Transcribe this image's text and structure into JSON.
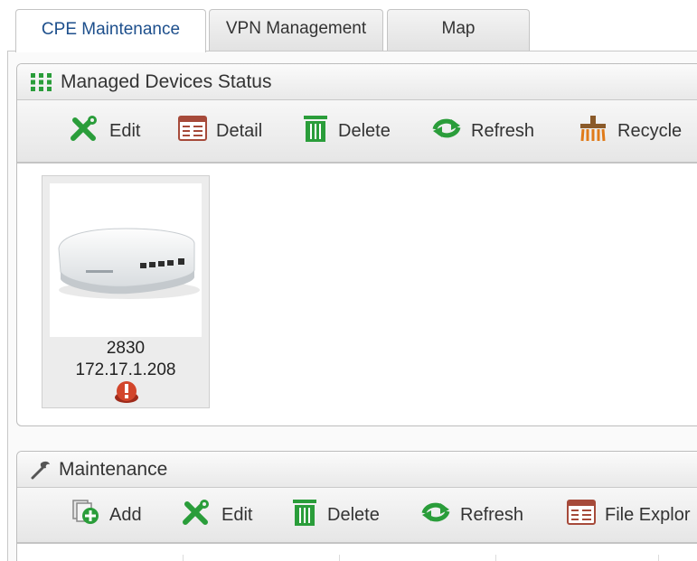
{
  "tabs": [
    {
      "label": "CPE Maintenance",
      "active": true
    },
    {
      "label": "VPN Management",
      "active": false
    },
    {
      "label": "Map",
      "active": false
    }
  ],
  "managed_devices": {
    "title": "Managed Devices Status",
    "toolbar": {
      "edit": "Edit",
      "detail": "Detail",
      "delete": "Delete",
      "refresh": "Refresh",
      "recycle": "Recycle"
    },
    "device": {
      "model": "2830",
      "ip": "172.17.1.208",
      "status_icon": "warning-icon"
    }
  },
  "maintenance": {
    "title": "Maintenance",
    "toolbar": {
      "add": "Add",
      "edit": "Edit",
      "delete": "Delete",
      "refresh": "Refresh",
      "file_explorer": "File Explor"
    }
  },
  "colors": {
    "active_tab_text": "#1d4f8c",
    "icon_green": "#2a9d3a",
    "icon_red": "#c0392b",
    "icon_orange": "#e07b1a"
  }
}
